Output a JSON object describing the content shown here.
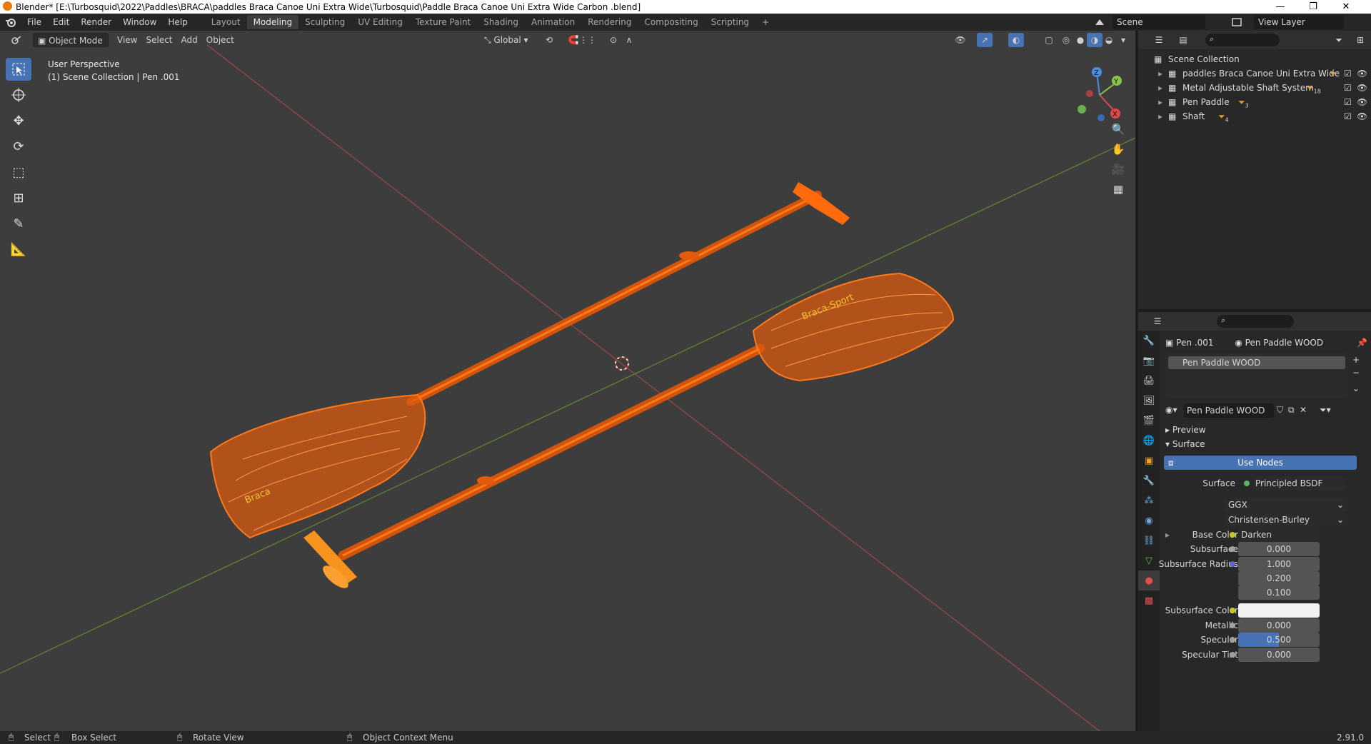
{
  "title_bar": {
    "title": "Blender* [E:\\Turbosquid\\2022\\Paddles\\BRACA\\paddles Braca Canoe Uni Extra Wide\\Turbosquid\\Paddle Braca Canoe Uni Extra Wide  Carbon .blend]",
    "minimize": "—",
    "restore": "❐",
    "close": "✕"
  },
  "menu": {
    "items": [
      "File",
      "Edit",
      "Render",
      "Window",
      "Help"
    ],
    "workspaces": [
      "Layout",
      "Modeling",
      "Sculpting",
      "UV Editing",
      "Texture Paint",
      "Shading",
      "Animation",
      "Rendering",
      "Compositing",
      "Scripting"
    ],
    "active_workspace": "Modeling",
    "add_tab": "+",
    "scene_label": "Scene",
    "view_layer_label": "View Layer"
  },
  "viewport_header": {
    "mode": "Object Mode",
    "menus": [
      "View",
      "Select",
      "Add",
      "Object"
    ],
    "orientation": "Global"
  },
  "viewport": {
    "perspective": "User Perspective",
    "collection_info": "(1) Scene Collection | Pen .001",
    "gizmo_axes": [
      "Z",
      "Y",
      "X"
    ]
  },
  "outliner": {
    "root": "Scene Collection",
    "items": [
      {
        "label": "paddles Braca Canoe Uni Extra Wide",
        "badge": ""
      },
      {
        "label": "Metal Adjustable Shaft System",
        "badge": "18"
      },
      {
        "label": "Pen Paddle",
        "badge": "3"
      },
      {
        "label": "Shaft",
        "badge": "4"
      }
    ]
  },
  "properties": {
    "breadcrumb_object": "Pen .001",
    "breadcrumb_material": "Pen Paddle WOOD",
    "material_slot": "Pen Paddle WOOD",
    "material_name": "Pen Paddle WOOD",
    "panel_preview": "Preview",
    "panel_surface": "Surface",
    "use_nodes": "Use Nodes",
    "surface_label": "Surface",
    "surface_value": "Principled BSDF",
    "distribution": "GGX",
    "subsurface_method": "Christensen-Burley",
    "rows": [
      {
        "label": "Base Color",
        "value": "Darken",
        "dot": "#c7c729"
      },
      {
        "label": "Subsurface",
        "value": "0.000",
        "dot": "#a1a1a1"
      },
      {
        "label": "Subsurface Radius",
        "value": "1.000",
        "dot": "#6363c7"
      },
      {
        "label": "",
        "value": "0.200",
        "dot": ""
      },
      {
        "label": "",
        "value": "0.100",
        "dot": ""
      },
      {
        "label": "Subsurface Color",
        "value": "",
        "dot": "#c7c729"
      },
      {
        "label": "Metallic",
        "value": "0.000",
        "dot": "#a1a1a1"
      },
      {
        "label": "Specular",
        "value": "0.500",
        "dot": "#a1a1a1"
      },
      {
        "label": "Specular Tint",
        "value": "0.000",
        "dot": "#a1a1a1"
      }
    ],
    "specular_fraction": 0.5
  },
  "status_bar": {
    "select": "Select",
    "box_select": "Box Select",
    "rotate_view": "Rotate View",
    "context_menu": "Object Context Menu",
    "version": "2.91.0"
  }
}
